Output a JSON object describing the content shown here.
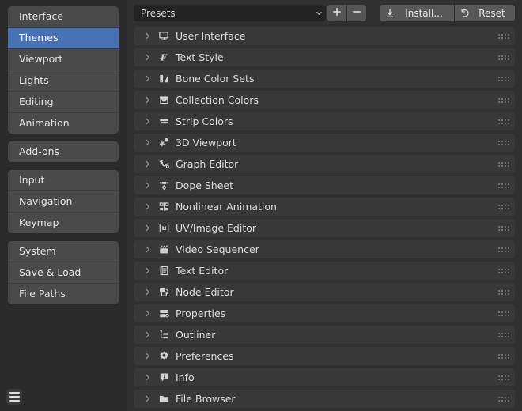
{
  "sidebar": {
    "groups": [
      {
        "items": [
          {
            "label": "Interface",
            "selected": false
          },
          {
            "label": "Themes",
            "selected": true
          },
          {
            "label": "Viewport",
            "selected": false
          },
          {
            "label": "Lights",
            "selected": false
          },
          {
            "label": "Editing",
            "selected": false
          },
          {
            "label": "Animation",
            "selected": false
          }
        ]
      },
      {
        "items": [
          {
            "label": "Add-ons",
            "selected": false
          }
        ]
      },
      {
        "items": [
          {
            "label": "Input",
            "selected": false
          },
          {
            "label": "Navigation",
            "selected": false
          },
          {
            "label": "Keymap",
            "selected": false
          }
        ]
      },
      {
        "items": [
          {
            "label": "System",
            "selected": false
          },
          {
            "label": "Save & Load",
            "selected": false
          },
          {
            "label": "File Paths",
            "selected": false
          }
        ]
      }
    ],
    "menu_icon": "hamburger-menu-icon"
  },
  "header": {
    "preset": {
      "value": "Presets",
      "placeholder": "Presets",
      "chevron_icon": "chevron-down-icon"
    },
    "add_label": "+",
    "add_icon": "plus-icon",
    "remove_label": "–",
    "remove_icon": "minus-icon",
    "install_label": "Install...",
    "install_icon": "download-icon",
    "reset_label": "Reset",
    "reset_icon": "undo-icon"
  },
  "theme_list": {
    "expand_icon": "chevron-right-icon",
    "grip_icon": "drag-grip-icon",
    "rows": [
      {
        "label": "User Interface",
        "icon": "monitor-icon"
      },
      {
        "label": "Text Style",
        "icon": "font-icon"
      },
      {
        "label": "Bone Color Sets",
        "icon": "bone-color-icon"
      },
      {
        "label": "Collection Colors",
        "icon": "collection-icon"
      },
      {
        "label": "Strip Colors",
        "icon": "strip-icon"
      },
      {
        "label": "3D Viewport",
        "icon": "viewport-3d-icon"
      },
      {
        "label": "Graph Editor",
        "icon": "graph-curve-icon"
      },
      {
        "label": "Dope Sheet",
        "icon": "dopesheet-icon"
      },
      {
        "label": "Nonlinear Animation",
        "icon": "nla-icon"
      },
      {
        "label": "UV/Image Editor",
        "icon": "uv-image-icon"
      },
      {
        "label": "Video Sequencer",
        "icon": "clapperboard-icon"
      },
      {
        "label": "Text Editor",
        "icon": "text-document-icon"
      },
      {
        "label": "Node Editor",
        "icon": "node-icon"
      },
      {
        "label": "Properties",
        "icon": "properties-icon"
      },
      {
        "label": "Outliner",
        "icon": "outliner-tree-icon"
      },
      {
        "label": "Preferences",
        "icon": "gear-icon"
      },
      {
        "label": "Info",
        "icon": "info-icon"
      },
      {
        "label": "File Browser",
        "icon": "folder-icon"
      }
    ]
  },
  "colors": {
    "background": "#2b2b2b",
    "panel": "#303030",
    "row": "#383838",
    "sidebar_item": "#4a4a4a",
    "accent_selected": "#4772b3",
    "text": "#dcdcdc",
    "field": "#232323",
    "button": "#585858"
  }
}
